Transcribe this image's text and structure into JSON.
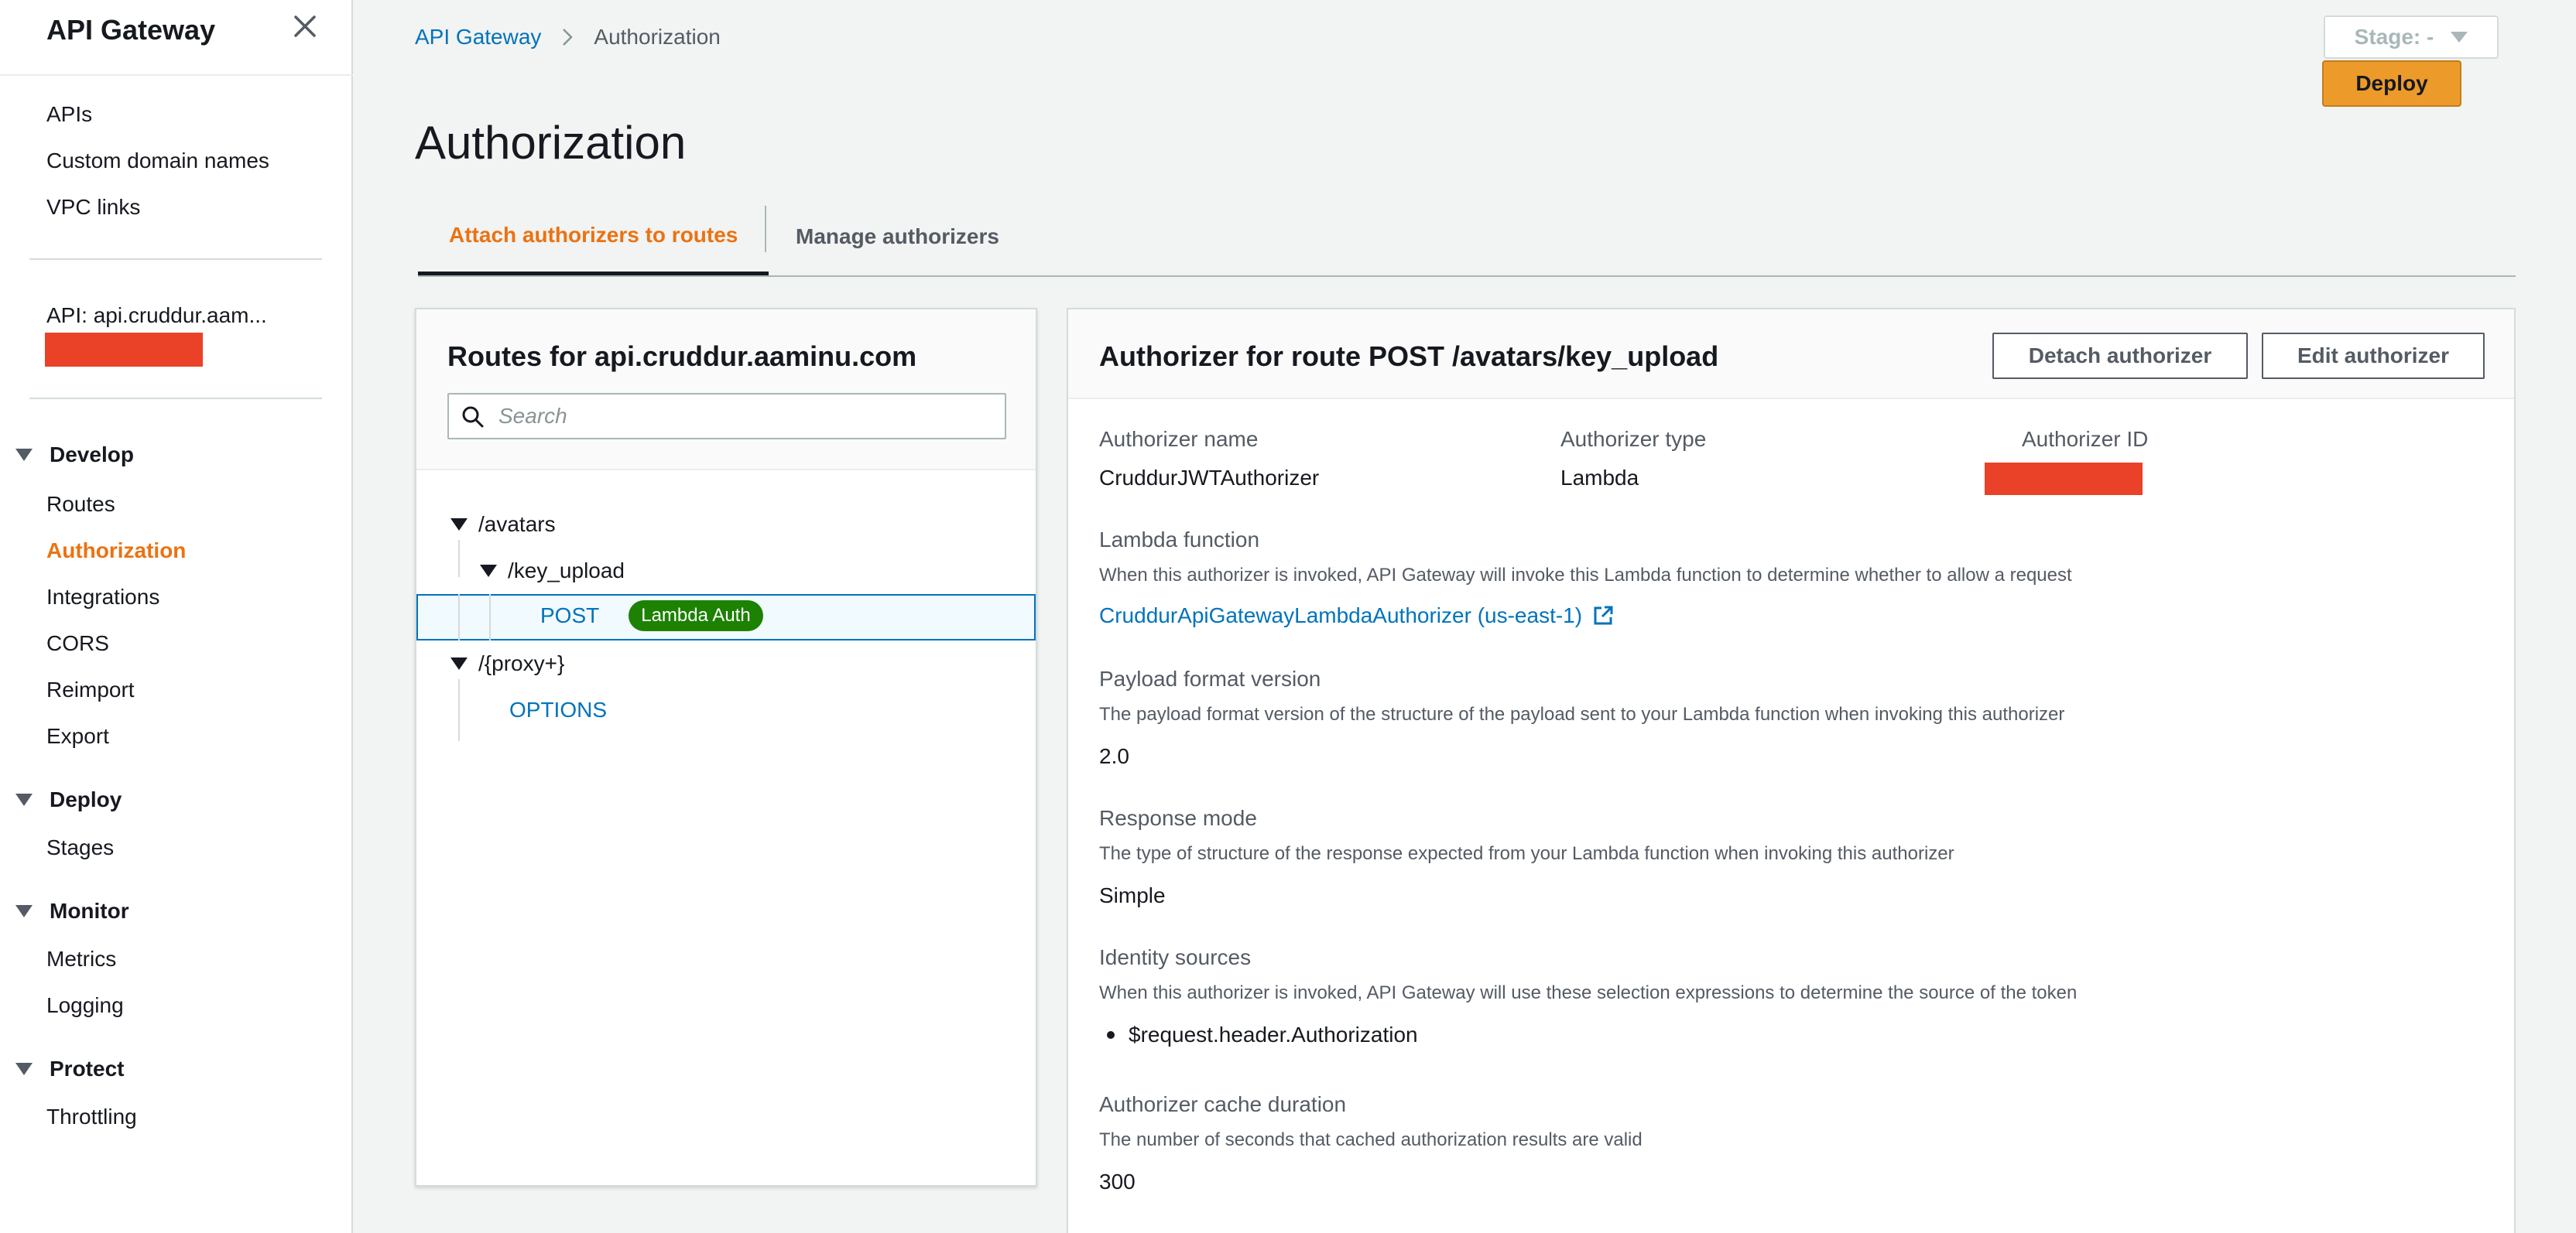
{
  "sidebar": {
    "title": "API Gateway",
    "top_links": [
      "APIs",
      "Custom domain names",
      "VPC links"
    ],
    "api_label": "API: api.cruddur.aam...",
    "sections": [
      {
        "label": "Develop",
        "items": [
          "Routes",
          "Authorization",
          "Integrations",
          "CORS",
          "Reimport",
          "Export"
        ]
      },
      {
        "label": "Deploy",
        "items": [
          "Stages"
        ]
      },
      {
        "label": "Monitor",
        "items": [
          "Metrics",
          "Logging"
        ]
      },
      {
        "label": "Protect",
        "items": [
          "Throttling"
        ]
      }
    ],
    "active_item": "Authorization"
  },
  "breadcrumb": {
    "parent": "API Gateway",
    "current": "Authorization"
  },
  "stage": {
    "label": "Stage: -"
  },
  "deploy_label": "Deploy",
  "page_title": "Authorization",
  "tabs": [
    {
      "label": "Attach authorizers to routes",
      "active": true
    },
    {
      "label": "Manage authorizers",
      "active": false
    }
  ],
  "routes": {
    "title": "Routes for api.cruddur.aaminu.com",
    "search_placeholder": "Search",
    "tree": {
      "avatars": "/avatars",
      "key_upload": "/key_upload",
      "post": "POST",
      "post_badge": "Lambda Auth",
      "proxy": "/{proxy+}",
      "options": "OPTIONS"
    }
  },
  "authorizer": {
    "title": "Authorizer for route POST /avatars/key_upload",
    "detach_label": "Detach authorizer",
    "edit_label": "Edit authorizer",
    "name_label": "Authorizer name",
    "name_value": "CruddurJWTAuthorizer",
    "type_label": "Authorizer type",
    "type_value": "Lambda",
    "id_label": "Authorizer ID",
    "lambda_label": "Lambda function",
    "lambda_desc": "When this authorizer is invoked, API Gateway will invoke this Lambda function to determine whether to allow a request",
    "lambda_link": "CruddurApiGatewayLambdaAuthorizer (us-east-1)",
    "payload_label": "Payload format version",
    "payload_desc": "The payload format version of the structure of the payload sent to your Lambda function when invoking this authorizer",
    "payload_value": "2.0",
    "response_label": "Response mode",
    "response_desc": "The type of structure of the response expected from your Lambda function when invoking this authorizer",
    "response_value": "Simple",
    "identity_label": "Identity sources",
    "identity_desc": "When this authorizer is invoked, API Gateway will use these selection expressions to determine the source of the token",
    "identity_value": "$request.header.Authorization",
    "cache_label": "Authorizer cache duration",
    "cache_desc": "The number of seconds that cached authorization results are valid",
    "cache_value": "300"
  },
  "colors": {
    "accent_orange": "#ec7211",
    "link_blue": "#0073bb",
    "badge_green": "#1d8102",
    "redaction": "#ea4129",
    "deploy_button": "#ec9b2b"
  }
}
